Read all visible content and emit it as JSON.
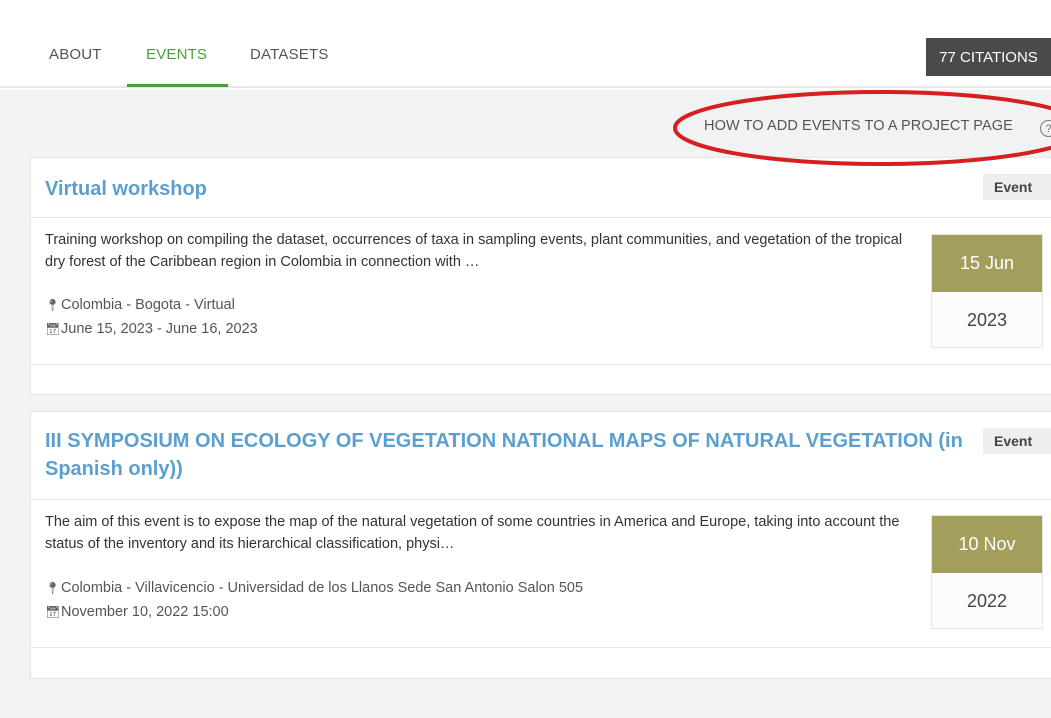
{
  "tabs": [
    {
      "label": "ABOUT"
    },
    {
      "label": "EVENTS"
    },
    {
      "label": "DATASETS"
    }
  ],
  "citations_label": "77 CITATIONS",
  "how_to_link": "HOW TO ADD EVENTS TO A PROJECT PAGE",
  "help_glyph": "?",
  "events": [
    {
      "title": "Virtual workshop",
      "badge": "Event",
      "description": "Training workshop on compiling the dataset, occurrences of taxa in sampling events, plant communities, and vegetation of the tropical dry forest of the Caribbean region in Colombia in connection with …",
      "location": "Colombia - Bogota - Virtual",
      "dates": "June 15, 2023 - June 16, 2023",
      "day_month": "15 Jun",
      "year": "2023"
    },
    {
      "title": "III SYMPOSIUM ON ECOLOGY OF VEGETATION NATIONAL MAPS OF NATURAL VEGETATION (in Spanish only))",
      "badge": "Event",
      "description": "The aim of this event is to expose the map of the natural vegetation of some countries in America and Europe, taking into account the status of the inventory and its hierarchical classification, physi…",
      "location": "Colombia - Villavicencio - Universidad de los Llanos Sede San Antonio Salon 505",
      "dates": "November 10, 2022 15:00",
      "day_month": "10 Nov",
      "year": "2022"
    }
  ],
  "colors": {
    "accent_green": "#4e9a3a",
    "title_blue": "#5c9fcf",
    "date_olive": "#a39e5c",
    "annotation_red": "#d61f1f"
  },
  "icons": {
    "location": "map-marker-icon",
    "calendar": "calendar-icon",
    "help": "help-circle-icon"
  }
}
